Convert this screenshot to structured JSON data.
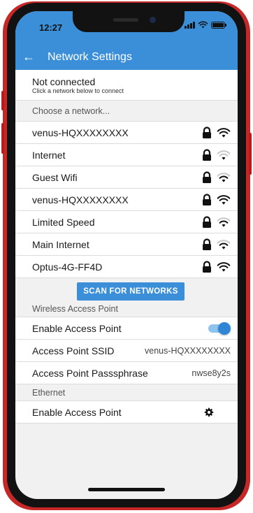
{
  "status_bar": {
    "time": "12:27"
  },
  "header": {
    "back_icon": "arrow-left-icon",
    "title": "Network Settings"
  },
  "colors": {
    "accent": "#3b8fd9",
    "frame": "#c62828",
    "toggle_on": "#2f86d6"
  },
  "connection": {
    "status": "Not connected",
    "hint": "Click a network below to connect"
  },
  "network_section": {
    "label": "Choose a network..."
  },
  "networks": [
    {
      "ssid": "venus-HQXXXXXXXX",
      "locked": true,
      "signal": "strong"
    },
    {
      "ssid": "Internet",
      "locked": true,
      "signal": "weak"
    },
    {
      "ssid": "Guest Wifi",
      "locked": true,
      "signal": "medium"
    },
    {
      "ssid": "venus-HQXXXXXXXX",
      "locked": true,
      "signal": "strong"
    },
    {
      "ssid": "Limited Speed",
      "locked": true,
      "signal": "medium"
    },
    {
      "ssid": "Main Internet",
      "locked": true,
      "signal": "medium"
    },
    {
      "ssid": "Optus-4G-FF4D",
      "locked": true,
      "signal": "strong"
    }
  ],
  "scan_button": {
    "label": "SCAN FOR NETWORKS"
  },
  "access_point": {
    "section_label": "Wireless Access Point",
    "enable_label": "Enable Access Point",
    "enabled": true,
    "ssid_label": "Access Point SSID",
    "ssid_value": "venus-HQXXXXXXXX",
    "passphrase_label": "Access Point Passsphrase",
    "passphrase_value": "nwse8y2s"
  },
  "ethernet": {
    "section_label": "Ethernet",
    "enable_label": "Enable Access Point",
    "settings_icon": "gear-icon"
  }
}
